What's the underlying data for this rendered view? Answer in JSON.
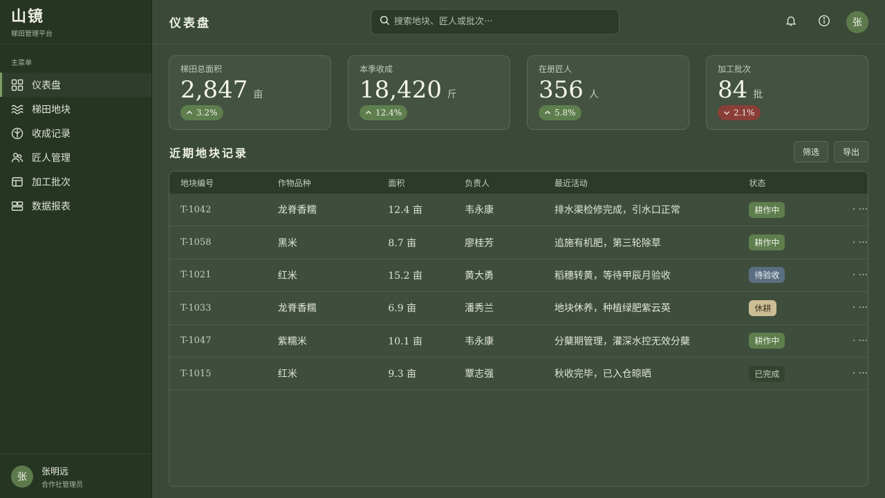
{
  "brand": {
    "title": "山镜",
    "subtitle": "梯田管理平台"
  },
  "sidebar": {
    "heading": "主菜单",
    "items": [
      {
        "label": "仪表盘",
        "icon": "grid-icon",
        "active": true
      },
      {
        "label": "梯田地块",
        "icon": "waves-icon",
        "active": false
      },
      {
        "label": "收成记录",
        "icon": "leaf-icon",
        "active": false
      },
      {
        "label": "匠人管理",
        "icon": "users-icon",
        "active": false
      },
      {
        "label": "加工批次",
        "icon": "layout-icon",
        "active": false
      },
      {
        "label": "数据报表",
        "icon": "report-icon",
        "active": false
      }
    ]
  },
  "user": {
    "avatar": "张",
    "name": "张明远",
    "role": "合作社管理员"
  },
  "header": {
    "title": "仪表盘",
    "search_placeholder": "搜索地块、匠人或批次···",
    "avatar": "张"
  },
  "stats": [
    {
      "label": "梯田总面积",
      "value": "2,847",
      "unit": "亩",
      "change": "3.2%",
      "trend": "up"
    },
    {
      "label": "本季收成",
      "value": "18,420",
      "unit": "斤",
      "change": "12.4%",
      "trend": "up"
    },
    {
      "label": "在册匠人",
      "value": "356",
      "unit": "人",
      "change": "5.8%",
      "trend": "up"
    },
    {
      "label": "加工批次",
      "value": "84",
      "unit": "批",
      "change": "2.1%",
      "trend": "down"
    }
  ],
  "section": {
    "title": "近期地块记录",
    "filter_label": "筛选",
    "export_label": "导出"
  },
  "table": {
    "columns": [
      "地块编号",
      "作物品种",
      "面积",
      "负责人",
      "最近活动",
      "状态"
    ],
    "rows": [
      {
        "id": "T-1042",
        "crop": "龙脊香糯",
        "area": "12.4 亩",
        "owner": "韦永康",
        "activity": "排水渠检修完成，引水口正常",
        "status": "耕作中",
        "status_tone": "green",
        "more": "· ···"
      },
      {
        "id": "T-1058",
        "crop": "黑米",
        "area": "8.7 亩",
        "owner": "廖桂芳",
        "activity": "追施有机肥，第三轮除草",
        "status": "耕作中",
        "status_tone": "green",
        "more": "· ···"
      },
      {
        "id": "T-1021",
        "crop": "红米",
        "area": "15.2 亩",
        "owner": "黄大勇",
        "activity": "稻穗转黄，等待甲辰月验收",
        "status": "待验收",
        "status_tone": "blue",
        "more": "· ···"
      },
      {
        "id": "T-1033",
        "crop": "龙脊香糯",
        "area": "6.9 亩",
        "owner": "潘秀兰",
        "activity": "地块休养，种植绿肥紫云英",
        "status": "休耕",
        "status_tone": "tan",
        "more": "· ···"
      },
      {
        "id": "T-1047",
        "crop": "紫糯米",
        "area": "10.1 亩",
        "owner": "韦永康",
        "activity": "分蘖期管理，灌深水控无效分蘖",
        "status": "耕作中",
        "status_tone": "green",
        "more": "· ···"
      },
      {
        "id": "T-1015",
        "crop": "红米",
        "area": "9.3 亩",
        "owner": "覃志强",
        "activity": "秋收完毕，已入仓晾晒",
        "status": "已完成",
        "status_tone": "dark",
        "more": "· ···"
      }
    ]
  },
  "colors": {
    "accent": "#7f9c64",
    "badge_up": "#5e7e4e",
    "badge_down": "#8a3e38"
  }
}
